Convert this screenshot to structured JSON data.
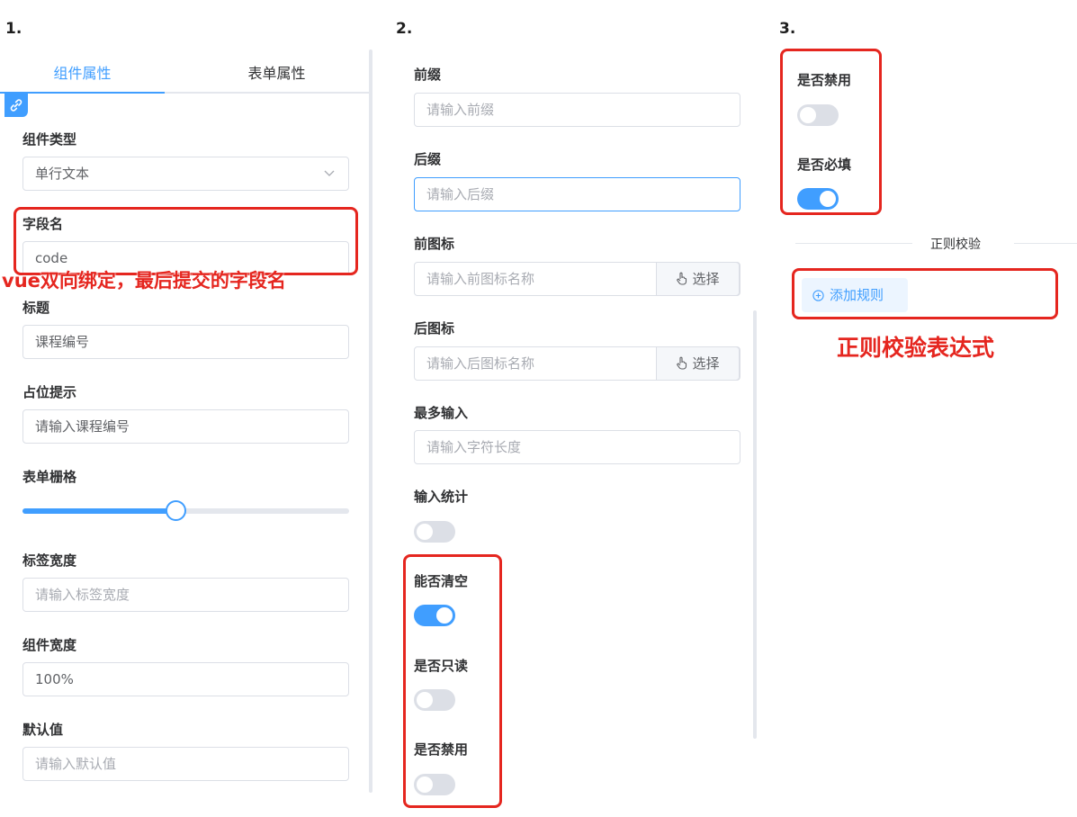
{
  "steps": {
    "one": "1.",
    "two": "2.",
    "three": "3."
  },
  "tabs": {
    "component": "组件属性",
    "form": "表单属性"
  },
  "panel1": {
    "component_type": {
      "label": "组件类型",
      "value": "单行文本"
    },
    "field_name": {
      "label": "字段名",
      "value": "code"
    },
    "title": {
      "label": "标题",
      "value": "课程编号"
    },
    "placeholder": {
      "label": "占位提示",
      "value": "请输入课程编号"
    },
    "grid": {
      "label": "表单栅格",
      "value": 0.47
    },
    "label_width": {
      "label": "标签宽度",
      "placeholder": "请输入标签宽度"
    },
    "component_width": {
      "label": "组件宽度",
      "value": "100%"
    },
    "default_value": {
      "label": "默认值",
      "placeholder": "请输入默认值"
    }
  },
  "panel2": {
    "prefix": {
      "label": "前缀",
      "placeholder": "请输入前缀"
    },
    "suffix": {
      "label": "后缀",
      "placeholder": "请输入后缀"
    },
    "prefix_icon": {
      "label": "前图标",
      "placeholder": "请输入前图标名称",
      "button": "选择"
    },
    "suffix_icon": {
      "label": "后图标",
      "placeholder": "请输入后图标名称",
      "button": "选择"
    },
    "maxlength": {
      "label": "最多输入",
      "placeholder": "请输入字符长度"
    },
    "show_word_limit": {
      "label": "输入统计",
      "on": false
    },
    "clearable": {
      "label": "能否清空",
      "on": true
    },
    "readonly": {
      "label": "是否只读",
      "on": false
    },
    "disabled": {
      "label": "是否禁用",
      "on": false
    }
  },
  "panel3": {
    "disabled": {
      "label": "是否禁用",
      "on": false
    },
    "required": {
      "label": "是否必填",
      "on": true
    },
    "divider": "正则校验",
    "add_rule": "添加规则"
  },
  "annotations": {
    "field_name_note": "vue双向绑定，最后提交的字段名",
    "regex_note": "正则校验表达式"
  },
  "colors": {
    "primary": "#409eff",
    "annotation": "#e5261f",
    "switch_off": "#dcdfe6"
  }
}
